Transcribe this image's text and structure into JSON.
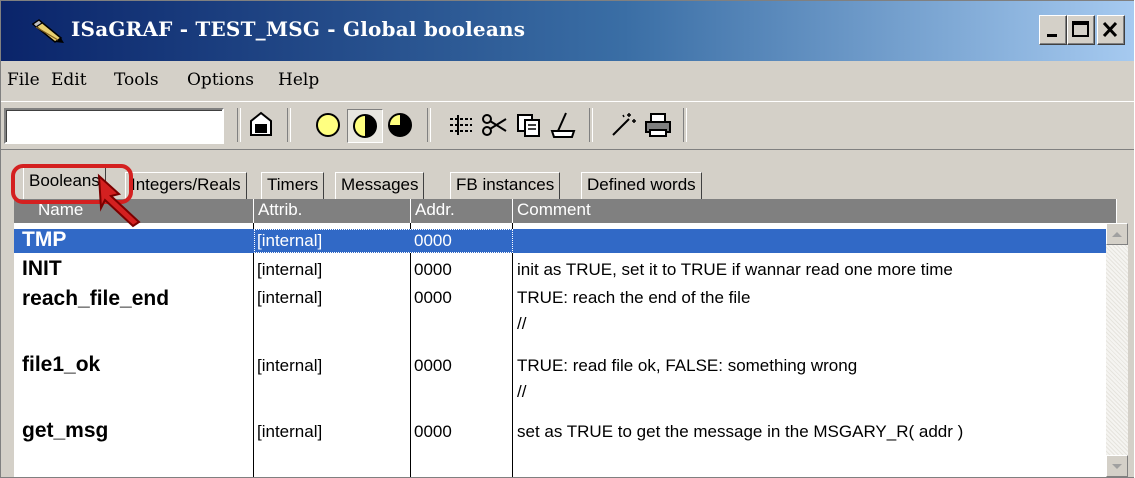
{
  "window": {
    "title": "ISaGRAF - TEST_MSG - Global booleans",
    "colors": {
      "titlebar_start": "#0a246a",
      "titlebar_end": "#a6caf0",
      "selection": "#3169c6",
      "highlight": "#d42020"
    }
  },
  "menu": [
    "File",
    "Edit",
    "Tools",
    "Options",
    "Help"
  ],
  "toolbar": {
    "input_value": "",
    "icons": [
      "open-folder-icon",
      "circle-empty-icon",
      "circle-half-icon",
      "circle-quarter-icon",
      "insert-list-icon",
      "scissors-icon",
      "copy-icon",
      "paint-bucket-icon",
      "magic-wand-icon",
      "printer-icon"
    ]
  },
  "tabs": [
    "Booleans",
    "Integers/Reals",
    "Timers",
    "Messages",
    "FB instances",
    "Defined words"
  ],
  "active_tab": "Booleans",
  "columns": [
    "Name",
    "Attrib.",
    "Addr.",
    "Comment"
  ],
  "rows": [
    {
      "name": "TMP",
      "attrib": "[internal]",
      "addr": "0000",
      "comment": "",
      "comment2": ""
    },
    {
      "name": "INIT",
      "attrib": "[internal]",
      "addr": "0000",
      "comment": "init as TRUE, set it to TRUE if wannar read one more time",
      "comment2": ""
    },
    {
      "name": "reach_file_end",
      "attrib": "[internal]",
      "addr": "0000",
      "comment": "TRUE: reach the end of the file",
      "comment2": "//"
    },
    {
      "name": "file1_ok",
      "attrib": "[internal]",
      "addr": "0000",
      "comment": "TRUE: read file ok, FALSE: something wrong",
      "comment2": "//"
    },
    {
      "name": "get_msg",
      "attrib": "[internal]",
      "addr": "0000",
      "comment": "set as TRUE to get the message in the MSGARY_R( addr )",
      "comment2": ""
    }
  ]
}
